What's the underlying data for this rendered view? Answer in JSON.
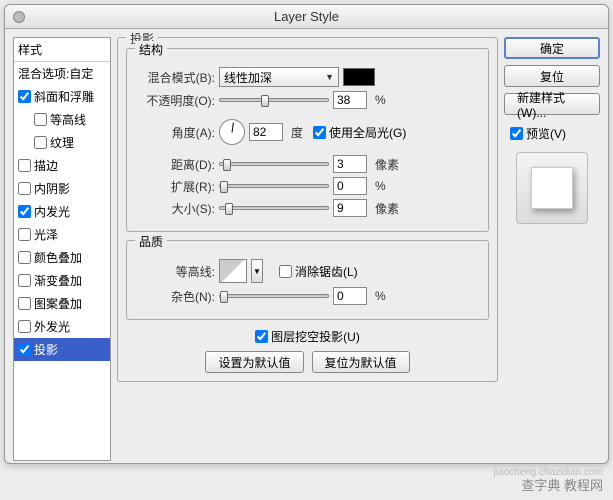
{
  "window": {
    "title": "Layer Style"
  },
  "sidebar": {
    "head": "样式",
    "blend": "混合选项:自定",
    "items": [
      {
        "label": "斜面和浮雕",
        "checked": true,
        "indent": false
      },
      {
        "label": "等高线",
        "checked": false,
        "indent": true
      },
      {
        "label": "纹理",
        "checked": false,
        "indent": true
      },
      {
        "label": "描边",
        "checked": false,
        "indent": false
      },
      {
        "label": "内阴影",
        "checked": false,
        "indent": false
      },
      {
        "label": "内发光",
        "checked": true,
        "indent": false
      },
      {
        "label": "光泽",
        "checked": false,
        "indent": false
      },
      {
        "label": "颜色叠加",
        "checked": false,
        "indent": false
      },
      {
        "label": "渐变叠加",
        "checked": false,
        "indent": false
      },
      {
        "label": "图案叠加",
        "checked": false,
        "indent": false
      },
      {
        "label": "外发光",
        "checked": false,
        "indent": false
      },
      {
        "label": "投影",
        "checked": true,
        "indent": false,
        "selected": true
      }
    ]
  },
  "panel": {
    "group": "投影",
    "structure": {
      "title": "结构",
      "blend_label": "混合模式(B):",
      "blend_value": "线性加深",
      "opacity_label": "不透明度(O):",
      "opacity_value": "38",
      "opacity_unit": "%",
      "angle_label": "角度(A):",
      "angle_value": "82",
      "angle_unit": "度",
      "global_light": "使用全局光(G)",
      "distance_label": "距离(D):",
      "distance_value": "3",
      "distance_unit": "像素",
      "spread_label": "扩展(R):",
      "spread_value": "0",
      "spread_unit": "%",
      "size_label": "大小(S):",
      "size_value": "9",
      "size_unit": "像素"
    },
    "quality": {
      "title": "品质",
      "contour_label": "等高线:",
      "antialias": "消除锯齿(L)",
      "noise_label": "杂色(N):",
      "noise_value": "0",
      "noise_unit": "%"
    },
    "knockout": "图层挖空投影(U)",
    "set_default": "设置为默认值",
    "reset_default": "复位为默认值"
  },
  "right": {
    "ok": "确定",
    "cancel": "复位",
    "new_style": "新建样式(W)...",
    "preview": "预览(V)"
  },
  "watermark": {
    "line1": "jiaocheng.chazidian.com",
    "line2": "查字典  教程网"
  }
}
